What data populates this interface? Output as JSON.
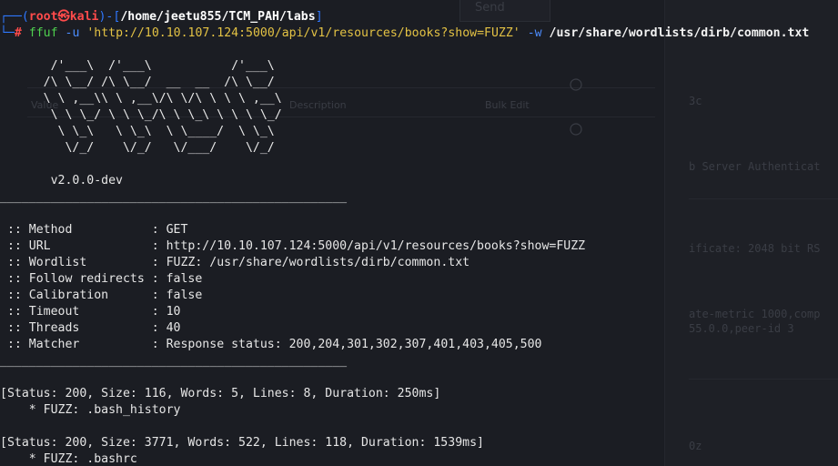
{
  "prompt": {
    "user": "root",
    "skull": "㉿",
    "host": "kali",
    "path": "/home/jeetu855/TCM_PAH/labs",
    "hash": "#"
  },
  "command": {
    "program": "ffuf",
    "flag_u": "-u",
    "url": "'http://10.10.107.124:5000/api/v1/resources/books?show=FUZZ'",
    "flag_w": "-w",
    "wordlist": "/usr/share/wordlists/dirb/common.txt"
  },
  "banner": {
    "art": [
      "       /'___\\  /'___\\           /'___\\",
      "      /\\ \\__/ /\\ \\__/  __  __  /\\ \\__/",
      "      \\ \\ ,__\\\\ \\ ,__\\/\\ \\/\\ \\ \\ \\ ,__\\",
      "       \\ \\ \\_/ \\ \\ \\_/\\ \\ \\_\\ \\ \\ \\ \\_/",
      "        \\ \\_\\   \\ \\_\\  \\ \\____/  \\ \\_\\",
      "         \\/_/    \\/_/   \\/___/    \\/_/"
    ],
    "version": "       v2.0.0-dev"
  },
  "separator": "________________________________________________",
  "config": [
    {
      "key": " :: Method           ",
      "value": ": GET"
    },
    {
      "key": " :: URL              ",
      "value": ": http://10.10.107.124:5000/api/v1/resources/books?show=FUZZ"
    },
    {
      "key": " :: Wordlist         ",
      "value": ": FUZZ: /usr/share/wordlists/dirb/common.txt"
    },
    {
      "key": " :: Follow redirects ",
      "value": ": false"
    },
    {
      "key": " :: Calibration      ",
      "value": ": false"
    },
    {
      "key": " :: Timeout          ",
      "value": ": 10"
    },
    {
      "key": " :: Threads          ",
      "value": ": 40"
    },
    {
      "key": " :: Matcher          ",
      "value": ": Response status: 200,204,301,302,307,401,403,405,500"
    }
  ],
  "results": [
    {
      "status": "[Status: 200, Size: 116, Words: 5, Lines: 8, Duration: 250ms]",
      "fuzz": "    * FUZZ: .bash_history"
    },
    {
      "status": "[Status: 200, Size: 3771, Words: 522, Lines: 118, Duration: 1539ms]",
      "fuzz": "    * FUZZ: .bashrc"
    }
  ],
  "background_ghost": {
    "send_button": "Send",
    "value_label": "Value",
    "description_label": "Description",
    "bulk_edit": "Bulk Edit",
    "right_lines": [
      "3c",
      "b Server Authenticat",
      "ificate: 2048 bit RS",
      "ate-metric 1000,comp",
      "55.0.0,peer-id 3",
      "0z"
    ]
  }
}
